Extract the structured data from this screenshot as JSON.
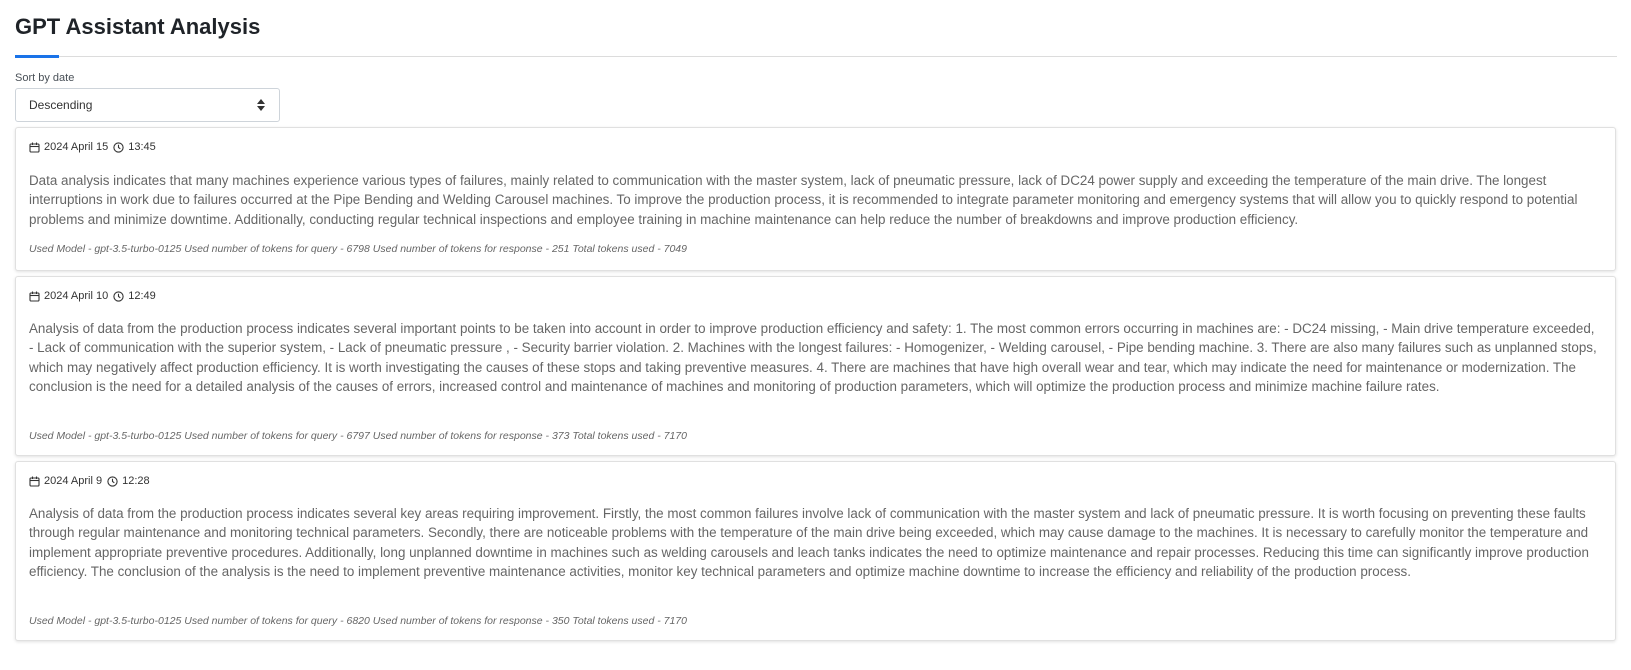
{
  "page": {
    "title": "GPT Assistant Analysis"
  },
  "sort": {
    "label": "Sort by date",
    "selected": "Descending"
  },
  "cards": [
    {
      "date": "2024 April 15",
      "time": "13:45",
      "text": "Data analysis indicates that many machines experience various types of failures, mainly related to communication with the master system, lack of pneumatic pressure, lack of DC24 power supply and exceeding the temperature of the main drive. The longest interruptions in work due to failures occurred at the Pipe Bending and Welding Carousel machines. To improve the production process, it is recommended to integrate parameter monitoring and emergency systems that will allow you to quickly respond to potential problems and minimize downtime. Additionally, conducting regular technical inspections and employee training in machine maintenance can help reduce the number of breakdowns and improve production efficiency.",
      "meta": "Used Model - gpt-3.5-turbo-0125 Used number of tokens for query - 6798 Used number of tokens for response - 251 Total tokens used - 7049"
    },
    {
      "date": "2024 April 10",
      "time": "12:49",
      "text": "Analysis of data from the production process indicates several important points to be taken into account in order to improve production efficiency and safety: 1. The most common errors occurring in machines are: - DC24 missing, - Main drive temperature exceeded, - Lack of communication with the superior system, - Lack of pneumatic pressure , - Security barrier violation. 2. Machines with the longest failures: - Homogenizer, - Welding carousel, - Pipe bending machine. 3. There are also many failures such as unplanned stops, which may negatively affect production efficiency. It is worth investigating the causes of these stops and taking preventive measures. 4. There are machines that have high overall wear and tear, which may indicate the need for maintenance or modernization. The conclusion is the need for a detailed analysis of the causes of errors, increased control and maintenance of machines and monitoring of production parameters, which will optimize the production process and minimize machine failure rates.",
      "meta": "Used Model - gpt-3.5-turbo-0125 Used number of tokens for query - 6797 Used number of tokens for response - 373 Total tokens used - 7170"
    },
    {
      "date": "2024 April 9",
      "time": "12:28",
      "text": "Analysis of data from the production process indicates several key areas requiring improvement. Firstly, the most common failures involve lack of communication with the master system and lack of pneumatic pressure. It is worth focusing on preventing these faults through regular maintenance and monitoring technical parameters. Secondly, there are noticeable problems with the temperature of the main drive being exceeded, which may cause damage to the machines. It is necessary to carefully monitor the temperature and implement appropriate preventive procedures. Additionally, long unplanned downtime in machines such as welding carousels and leach tanks indicates the need to optimize maintenance and repair processes. Reducing this time can significantly improve production efficiency. The conclusion of the analysis is the need to implement preventive maintenance activities, monitor key technical parameters and optimize machine downtime to increase the efficiency and reliability of the production process.",
      "meta": "Used Model - gpt-3.5-turbo-0125 Used number of tokens for query - 6820 Used number of tokens for response - 350 Total tokens used - 7170"
    }
  ],
  "icons": {
    "date": "calendar-icon",
    "time": "clock-icon",
    "select": "sort-caret-icon"
  },
  "colors": {
    "accent": "#1a73e8",
    "text_muted": "#666666"
  }
}
